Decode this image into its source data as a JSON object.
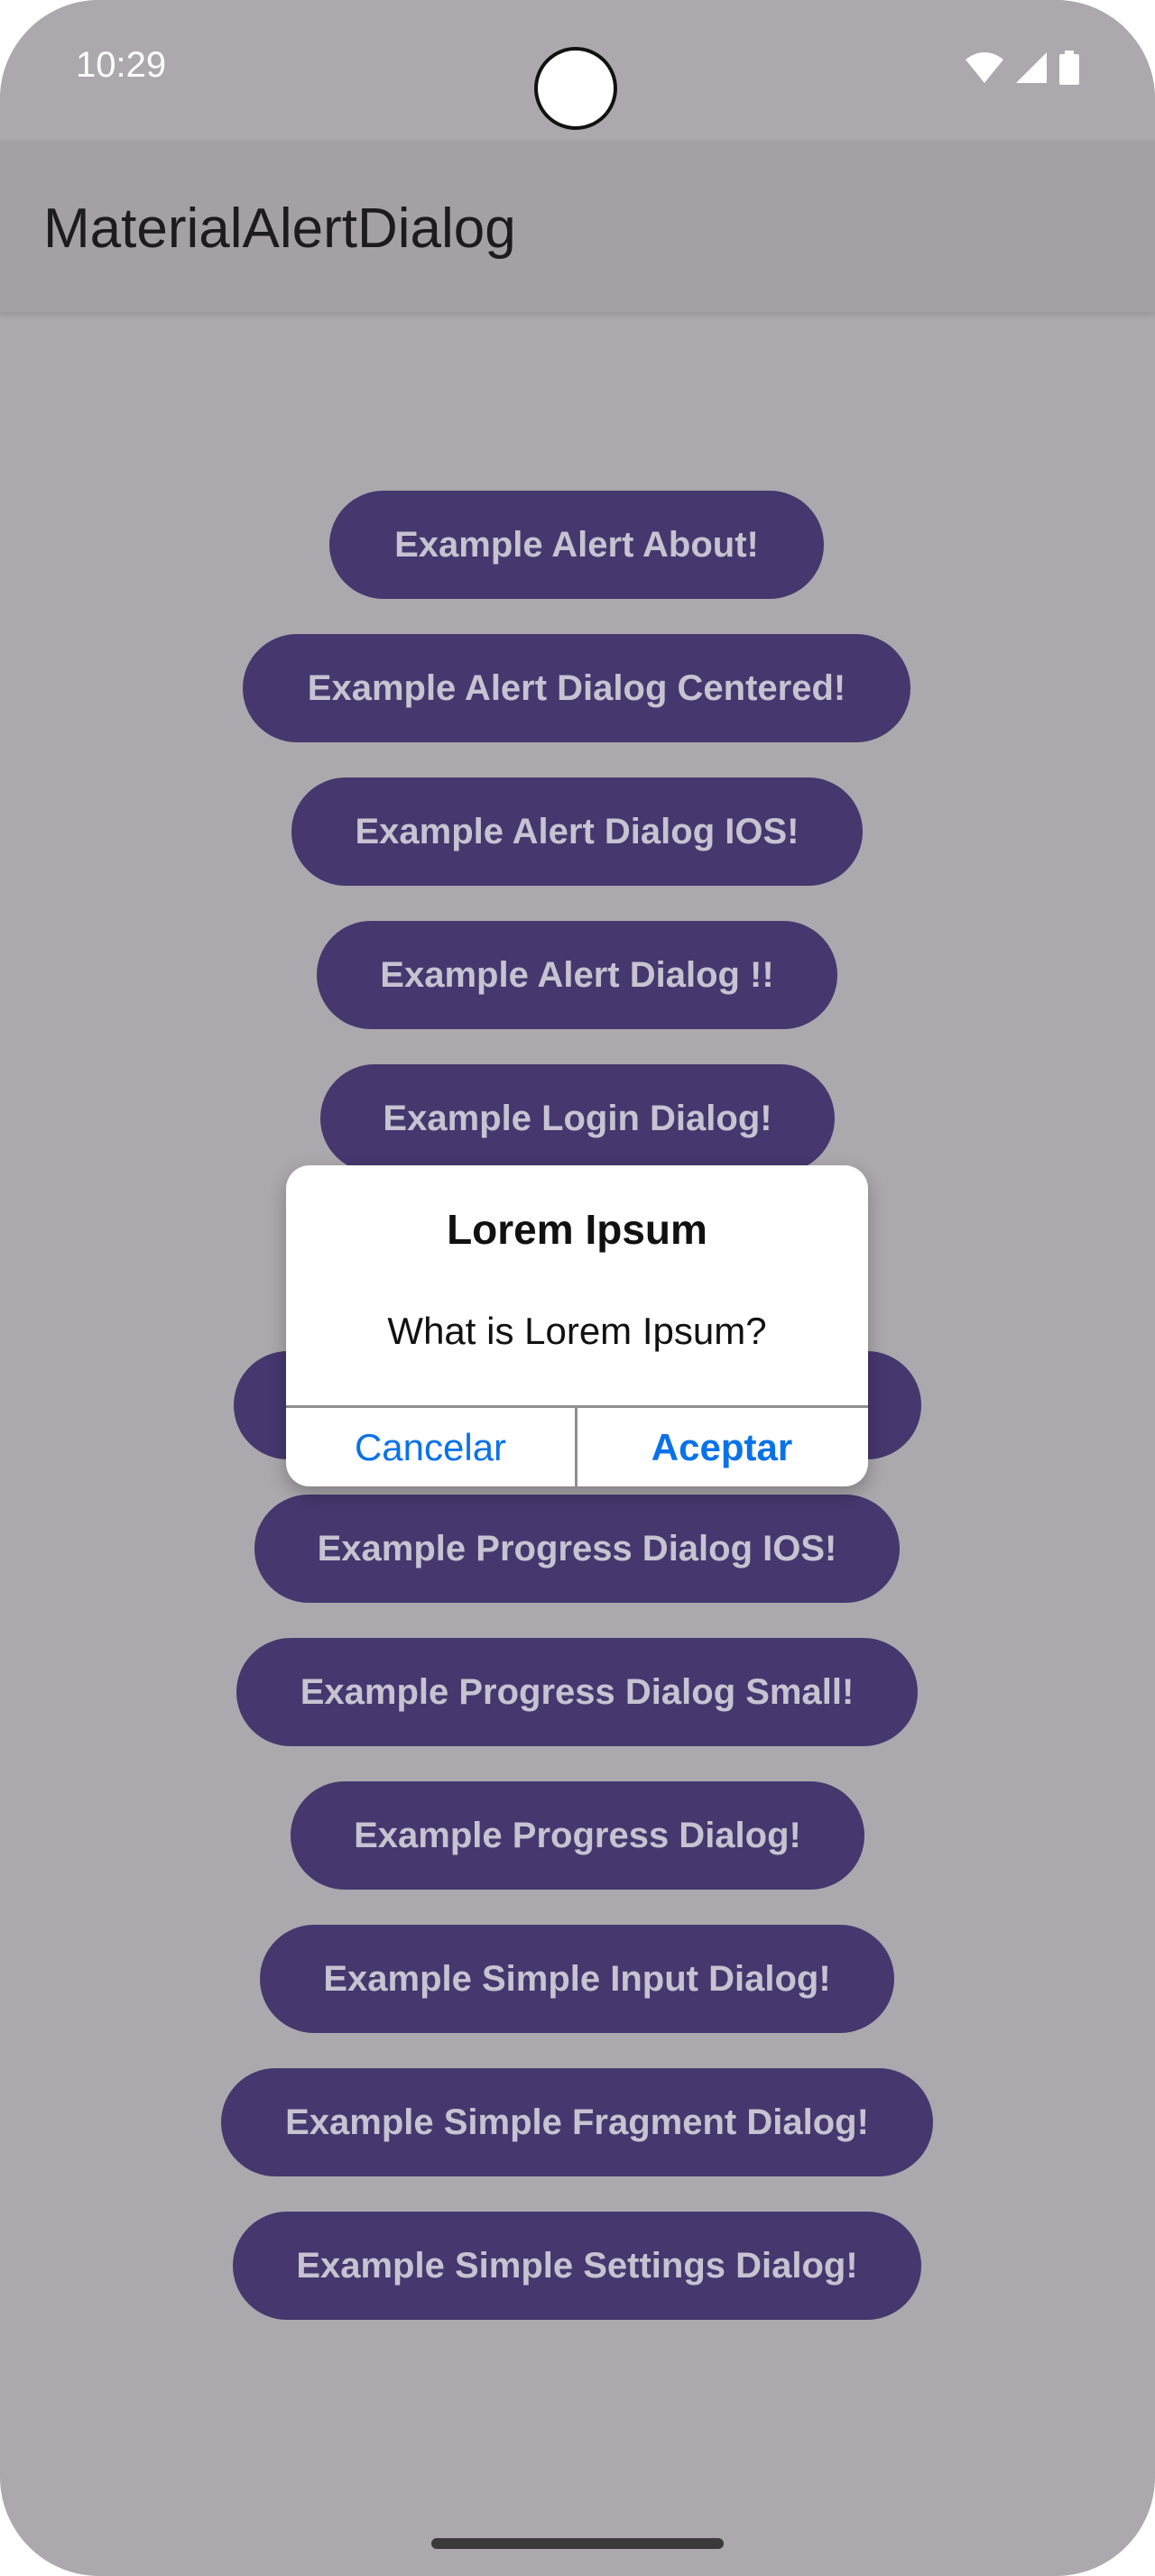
{
  "status_bar": {
    "time": "10:29",
    "icons": [
      "wifi-icon",
      "signal-icon",
      "battery-icon"
    ]
  },
  "app_bar": {
    "title": "MaterialAlertDialog"
  },
  "buttons": [
    "Example Alert About!",
    "Example Alert Dialog Centered!",
    "Example Alert Dialog IOS!",
    "Example Alert Dialog !!",
    "Example Login Dialog!",
    "",
    "Example Progress Dialog IOS!",
    "Example Progress Dialog Small!",
    "Example Progress Dialog!",
    "Example Simple Input Dialog!",
    "Example Simple Fragment Dialog!",
    "Example Simple Settings Dialog!"
  ],
  "dialog": {
    "title": "Lorem Ipsum",
    "message": "What is Lorem Ipsum?",
    "cancel_label": "Cancelar",
    "accept_label": "Aceptar"
  },
  "colors": {
    "scrim_background": "#aca8ad",
    "button_fill": "#46376e",
    "button_text": "#c8c2d1",
    "dialog_action": "#0a72e8"
  }
}
